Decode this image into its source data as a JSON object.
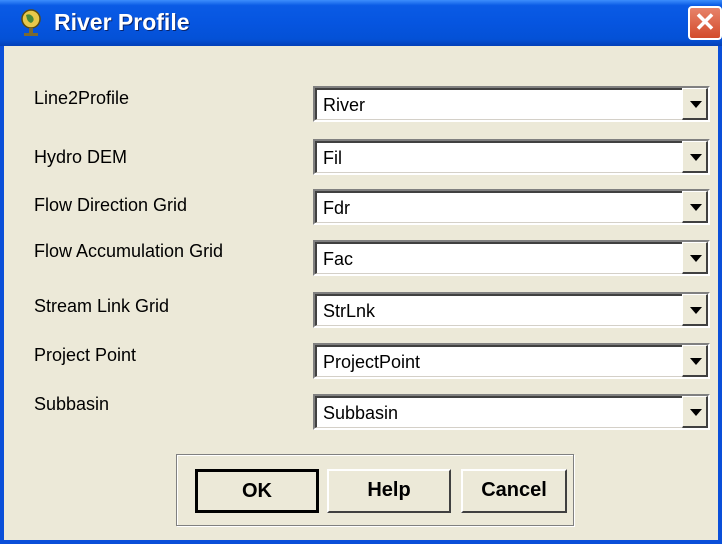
{
  "window": {
    "title": "River Profile",
    "close_icon": "close-x"
  },
  "fields": [
    {
      "label": "Line2Profile",
      "value": "River"
    },
    {
      "label": "Hydro DEM",
      "value": "Fil"
    },
    {
      "label": "Flow Direction Grid",
      "value": "Fdr"
    },
    {
      "label": "Flow Accumulation Grid",
      "value": "Fac"
    },
    {
      "label": "Stream Link Grid",
      "value": "StrLnk"
    },
    {
      "label": "Project Point",
      "value": "ProjectPoint"
    },
    {
      "label": "Subbasin",
      "value": "Subbasin"
    }
  ],
  "buttons": {
    "ok": "OK",
    "help": "Help",
    "cancel": "Cancel"
  },
  "colors": {
    "titlebar": "#0655E0",
    "dialog": "#ECE9D8",
    "close": "#D34B2B"
  }
}
